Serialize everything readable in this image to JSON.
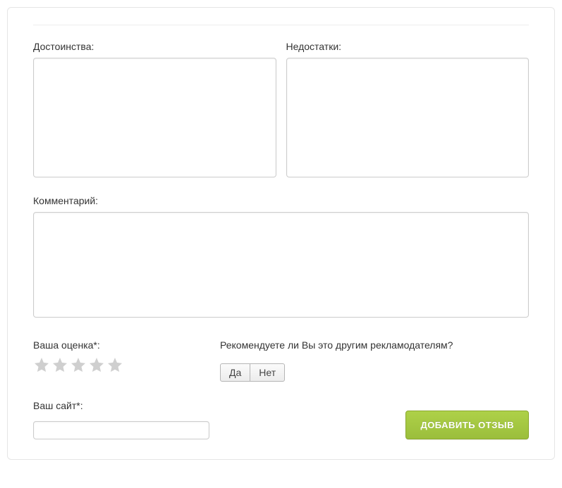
{
  "labels": {
    "pros": "Достоинства:",
    "cons": "Недостатки:",
    "comment": "Комментарий:",
    "rating": "Ваша оценка*:",
    "recommend": "Рекомендуете ли Вы это другим рекламодателям?",
    "site": "Ваш сайт*:"
  },
  "buttons": {
    "yes": "Да",
    "no": "Нет",
    "submit": "ДОБАВИТЬ ОТЗЫВ"
  },
  "values": {
    "pros": "",
    "cons": "",
    "comment": "",
    "site": ""
  },
  "rating": {
    "max": 5,
    "value": 0
  }
}
